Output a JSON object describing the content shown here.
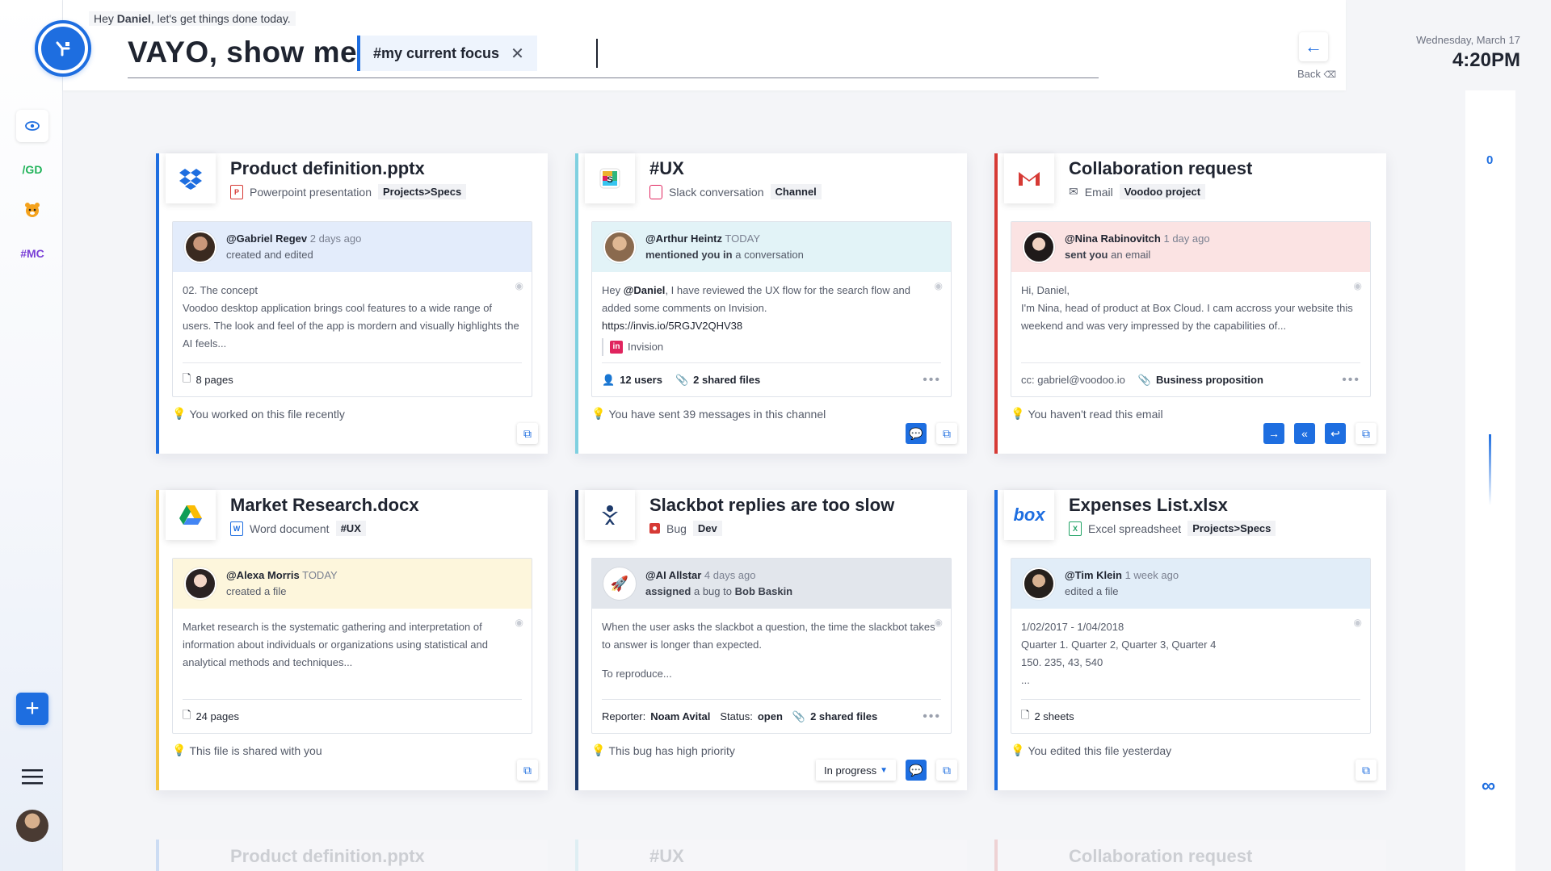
{
  "header": {
    "greeting_prefix": "Hey",
    "greeting_name": "Daniel",
    "greeting_suffix": ", let's get things done today.",
    "query_title": "VAYO, show me",
    "query_chip": "#my current focus",
    "back_label": "Back",
    "date": "Wednesday, March 17",
    "time": "4:20PM"
  },
  "sidebar": {
    "items": [
      {
        "label": "/GD",
        "color": "#21b35a"
      },
      {
        "label": "#MC",
        "color": "#7a3fd6"
      }
    ],
    "add_label": "+"
  },
  "right_panel": {
    "counter": "0",
    "infinity": "∞"
  },
  "cards": [
    {
      "title": "Product definition.pptx",
      "type_label": "Powerpoint presentation",
      "tag": "Projects>Specs",
      "accent": "#1e6ee0",
      "activity_user": "@Gabriel Regev",
      "activity_time": "2 days ago",
      "activity_line": "created and edited",
      "activity_bg": "#e3ecfb",
      "body": [
        "02. The concept",
        "Voodoo desktop application brings cool features to a wide range of users. The look and feel of the app is mordern and visually highlights the AI feels..."
      ],
      "footer": "8 pages",
      "hint": "You worked on this file recently"
    },
    {
      "title": "#UX",
      "type_label": "Slack conversation",
      "tag": "Channel",
      "accent": "#7fd0e0",
      "activity_user": "@Arthur Heintz",
      "activity_time": "TODAY",
      "activity_line_bold": "mentioned you in",
      "activity_line": "a conversation",
      "activity_bg": "#e2f3f7",
      "body_mention": "Hey ",
      "body_name": "@Daniel",
      "body_rest": ", I have reviewed the UX flow for the search flow and added some comments on Invision.",
      "link": "https://invis.io/5RGJV2QHV38",
      "ref": "Invision",
      "footer_users": "12 users",
      "footer_files": "2 shared files",
      "hint": "You have sent 39 messages in this channel"
    },
    {
      "title": "Collaboration request",
      "type_label": "Email",
      "tag": "Voodoo project",
      "accent": "#d63a35",
      "activity_user": "@Nina Rabinovitch",
      "activity_time": "1 day ago",
      "activity_line_bold": "sent you",
      "activity_line": "an email",
      "activity_bg": "#fbe3e3",
      "body": [
        "Hi, Daniel,",
        "I'm Nina, head of product at Box Cloud. I cam accross your website this weekend and was very impressed by the capabilities of..."
      ],
      "footer_cc": "cc: gabriel@voodoo.io",
      "footer_attach": "Business proposition",
      "hint": "You haven't read this email"
    },
    {
      "title": "Market Research.docx",
      "type_label": "Word document",
      "tag": "#UX",
      "accent": "#f5c542",
      "activity_user": "@Alexa Morris",
      "activity_time": "TODAY",
      "activity_line": "created a file",
      "activity_bg": "#fdf6dc",
      "body": [
        "Market research is the systematic gathering and interpretation of information about individuals or organizations using statistical and analytical methods and techniques..."
      ],
      "footer": "24 pages",
      "hint": "This file is shared with you"
    },
    {
      "title": "Slackbot replies are too slow",
      "type_label": "Bug",
      "tag": "Dev",
      "accent": "#1d3a6b",
      "activity_user": "@AI Allstar",
      "activity_time": "4 days ago",
      "activity_line_bold": "assigned",
      "activity_line": "a bug to",
      "activity_line_bold2": "Bob Baskin",
      "activity_bg": "#e2e6ec",
      "body": [
        "When the user asks the slackbot a question, the time the slackbot takes to answer is longer than expected.",
        "To reproduce..."
      ],
      "footer_reporter_label": "Reporter:",
      "footer_reporter": "Noam Avital",
      "footer_status_label": "Status:",
      "footer_status": "open",
      "footer_files": "2 shared files",
      "hint": "This bug has high priority",
      "status_dropdown": "In progress"
    },
    {
      "title": "Expenses List.xlsx",
      "type_label": "Excel spreadsheet",
      "tag": "Projects>Specs",
      "accent": "#1e6ee0",
      "activity_user": "@Tim Klein",
      "activity_time": "1 week ago",
      "activity_line": "edited a file",
      "activity_bg": "#e1edf8",
      "body": [
        "1/02/2017 - 1/04/2018",
        "Quarter 1. Quarter 2, Quarter 3, Quarter 4",
        "150. 235, 43, 540",
        "..."
      ],
      "footer": "2 sheets",
      "hint": "You edited this file yesterday"
    }
  ],
  "faded": [
    "Product definition.pptx",
    "#UX",
    "Collaboration request"
  ]
}
